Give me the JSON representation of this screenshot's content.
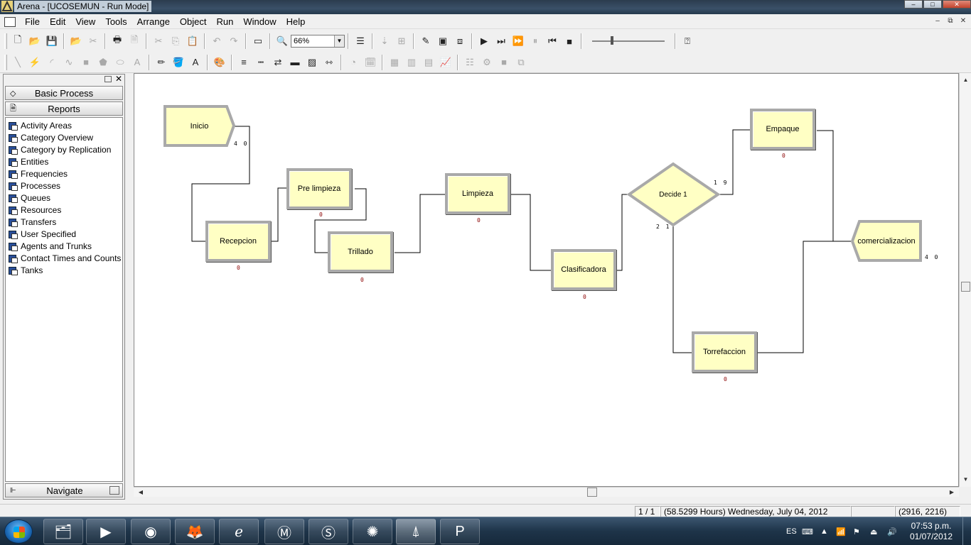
{
  "window": {
    "title": "Arena - [UCOSEMUN - Run Mode]",
    "buttons": {
      "minimize": "–",
      "maximize": "□",
      "close": "✕"
    }
  },
  "menu": {
    "items": [
      "File",
      "Edit",
      "View",
      "Tools",
      "Arrange",
      "Object",
      "Run",
      "Window",
      "Help"
    ],
    "mdi_buttons": [
      "–",
      "⧉",
      "✕"
    ]
  },
  "toolbar": {
    "zoom_value": "66%"
  },
  "panel": {
    "groups": [
      {
        "label": "Basic Process",
        "icon": "diamond-icon"
      },
      {
        "label": "Reports",
        "icon": "reports-icon"
      }
    ],
    "reports": [
      "Activity Areas",
      "Category Overview",
      "Category by Replication",
      "Entities",
      "Frequencies",
      "Processes",
      "Queues",
      "Resources",
      "Transfers",
      "User Specified",
      "Agents and Trunks",
      "Contact Times and Counts",
      "Tanks"
    ],
    "navigate_label": "Navigate"
  },
  "flowchart": {
    "modules": {
      "inicio": {
        "label": "Inicio",
        "type": "create"
      },
      "recepcion": {
        "label": "Recepcion",
        "type": "process"
      },
      "pre_limpieza": {
        "label": "Pre limpieza",
        "type": "process"
      },
      "trillado": {
        "label": "Trillado",
        "type": "process"
      },
      "limpieza": {
        "label": "Limpieza",
        "type": "process"
      },
      "clasificadora": {
        "label": "Clasificadora",
        "type": "process"
      },
      "decide": {
        "label": "Decide 1",
        "type": "decide"
      },
      "empaque": {
        "label": "Empaque",
        "type": "process"
      },
      "torrefaccion": {
        "label": "Torrefaccion",
        "type": "process"
      },
      "comercializacion": {
        "label": "comercializacion",
        "type": "dispose"
      }
    },
    "counters": {
      "inicio": "4 0",
      "recepcion": "0",
      "pre_limpieza": "0",
      "trillado": "0",
      "limpieza": "0",
      "clasificadora": "0",
      "decide_true": "1 9",
      "decide_false": "2 1",
      "empaque": "0",
      "torrefaccion": "0",
      "comercializacion": "4 0"
    }
  },
  "status": {
    "page": "1 / 1",
    "sim_time": "(58.5299 Hours) Wednesday, July 04, 2012",
    "coords": "(2916, 2216)"
  },
  "taskbar": {
    "language": "ES",
    "time": "07:53 p.m.",
    "date": "01/07/2012",
    "apps": [
      "explorer-icon",
      "media-player-icon",
      "chrome-icon",
      "firefox-icon",
      "ie-icon",
      "movistar-icon",
      "skype-icon",
      "avast-icon",
      "arena-icon",
      "powerpoint-icon"
    ]
  },
  "colors": {
    "module_fill": "#ffffc4",
    "module_border": "#a9a9a9",
    "counter_red": "#8b0000"
  }
}
